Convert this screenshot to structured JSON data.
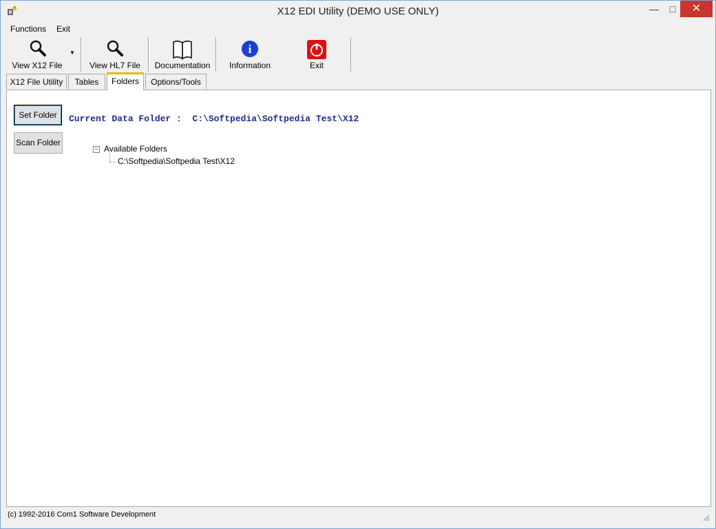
{
  "window": {
    "title": "X12 EDI Utility  (DEMO USE ONLY)",
    "minimize": "—",
    "maximize": "□",
    "close": "✕"
  },
  "menu": {
    "items": [
      "Functions",
      "Exit"
    ]
  },
  "toolbar": {
    "buttons": [
      {
        "label": "View X12 File",
        "icon": "magnifier-icon"
      },
      {
        "label": "View HL7 File",
        "icon": "magnifier-icon"
      },
      {
        "label": "Documentation",
        "icon": "book-icon"
      },
      {
        "label": "Information",
        "icon": "info-icon"
      },
      {
        "label": "Exit",
        "icon": "power-icon"
      }
    ],
    "dropdown_arrow": "▼",
    "info_glyph": "i",
    "colors": {
      "info": "#1a3fd6",
      "exit": "#e01010"
    }
  },
  "tabs": [
    {
      "label": "X12 File Utility",
      "active": false
    },
    {
      "label": "Tables",
      "active": false
    },
    {
      "label": "Folders",
      "active": true
    },
    {
      "label": "Options/Tools",
      "active": false
    }
  ],
  "folders": {
    "set_folder_label": "Set Folder",
    "scan_folder_label": "Scan Folder",
    "current_label": "Current Data Folder :  C:\\Softpedia\\Softpedia Test\\X12",
    "tree": {
      "toggle": "−",
      "root": "Available Folders",
      "children": [
        "C:\\Softpedia\\Softpedia Test\\X12"
      ]
    }
  },
  "status": {
    "text": "(c) 1992-2016 Com1 Software Development"
  }
}
